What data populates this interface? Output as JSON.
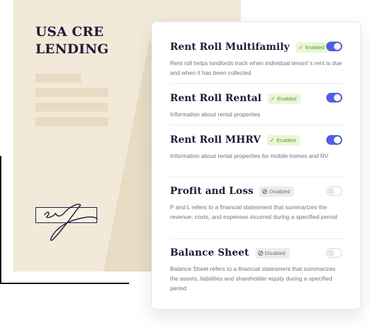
{
  "document": {
    "title": "USA CRE LENDING"
  },
  "settings": [
    {
      "title": "Rent Roll Multifamily",
      "status": "Enabled",
      "enabled": true,
      "description": "Rent roll helps landlords track when individual tenant`s rent is due and when it has been collected"
    },
    {
      "title": "Rent Roll Rental",
      "status": "Enabled",
      "enabled": true,
      "description": "Information about rental properties"
    },
    {
      "title": "Rent Roll MHRV",
      "status": "Enabled",
      "enabled": true,
      "description": "Information about rental properties for mobile homes and RV"
    },
    {
      "title": "Profit and Loss",
      "status": "Disabled",
      "enabled": false,
      "description": "P and L refers to a financial statesment that summarizes the revenue, costs, and expenses incurred during a specified period"
    },
    {
      "title": "Balance Sheet",
      "status": "Disabled",
      "enabled": false,
      "description": "Balance Sheet refers to a financial statesment that summarizes the assets, liabilities and shareholder equity during a specified period"
    }
  ],
  "colors": {
    "accent": "#4f5fe0",
    "enabled_badge": "#e9f6d7",
    "disabled_badge": "#ececef",
    "document_bg": "#f2e9d8"
  },
  "icons": {
    "enabled": "check-icon",
    "disabled": "disabled-icon"
  }
}
